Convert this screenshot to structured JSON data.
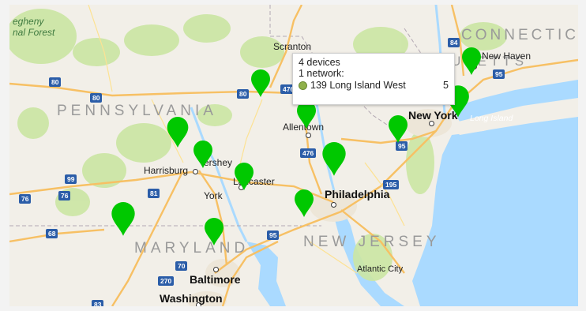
{
  "map": {
    "states": {
      "pennsylvania": "PENNSYLVANIA",
      "maryland": "MARYLAND",
      "new_jersey": "NEW JERSEY",
      "connecticut": "CONNECTICUT",
      "massachusetts": "MASSACHUSETTS"
    },
    "park": {
      "line1": "egheny",
      "line2": "nal Forest"
    },
    "cities": {
      "scranton": "Scranton",
      "new_haven": "New Haven",
      "allentown": "Allentown",
      "new_york": "New York",
      "long_island": "Long Island",
      "harrisburg": "Harrisburg",
      "hershey": "ershey",
      "lancaster": "Lancaster",
      "york": "York",
      "philadelphia": "Philadelphia",
      "baltimore": "Baltimore",
      "washington": "Washington",
      "atlantic_city": "Atlantic City"
    },
    "shields": {
      "i80_a": "80",
      "i80_b": "80",
      "i80_c": "80",
      "i84": "84",
      "i95_ct": "95",
      "i95_ny": "95",
      "i476_a": "476",
      "i476_b": "476",
      "i99": "99",
      "i76_a": "76",
      "i76_b": "76",
      "i81": "81",
      "i68": "68",
      "i95_md": "95",
      "i195": "195",
      "i70": "70",
      "i270": "270",
      "i83": "83"
    },
    "pin_color": "#00c800"
  },
  "tooltip": {
    "devices": "4 devices",
    "networks": "1 network:",
    "network_name": "139 Long Island West",
    "network_count": "5",
    "network_color": "#8fb04a"
  }
}
